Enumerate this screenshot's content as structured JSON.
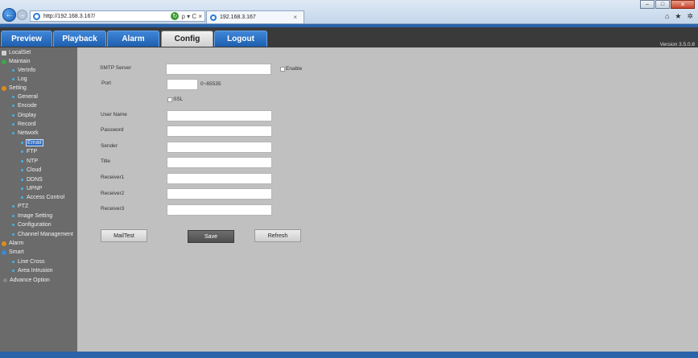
{
  "browser": {
    "url": "http://192.168.3.167/",
    "tab_title": "192.168.3.167",
    "back_glyph": "←",
    "forward_glyph": "→",
    "search_glyph": "ρ ▾ C ×",
    "tab_close": "×",
    "min_glyph": "–",
    "max_glyph": "□",
    "close_glyph": "✕",
    "home_glyph": "⌂",
    "star_glyph": "★",
    "gear_glyph": "✲"
  },
  "menu": {
    "preview": "Preview",
    "playback": "Playback",
    "alarm": "Alarm",
    "config": "Config",
    "logout": "Logout",
    "active": "Config"
  },
  "version": "Version 3.5.0.8",
  "sidebar": {
    "items": [
      {
        "label": "LocalSet"
      },
      {
        "label": "Maintain"
      },
      {
        "label": "VerInfo"
      },
      {
        "label": "Log"
      },
      {
        "label": "Setting"
      },
      {
        "label": "General"
      },
      {
        "label": "Encode"
      },
      {
        "label": "Display"
      },
      {
        "label": "Record"
      },
      {
        "label": "Network"
      },
      {
        "label": "Email"
      },
      {
        "label": "FTP"
      },
      {
        "label": "NTP"
      },
      {
        "label": "Cloud"
      },
      {
        "label": "DDNS"
      },
      {
        "label": "UPNP"
      },
      {
        "label": "Access Control"
      },
      {
        "label": "PTZ"
      },
      {
        "label": "Image Setting"
      },
      {
        "label": "Configuration"
      },
      {
        "label": "Channel Management"
      },
      {
        "label": "Alarm"
      },
      {
        "label": "Smart"
      },
      {
        "label": "Line Cross"
      },
      {
        "label": "Area Intrusion"
      },
      {
        "label": "Advance Option"
      }
    ]
  },
  "form": {
    "smtp_label": "SMTP Server",
    "smtp_value": "",
    "enable_label": "Enable",
    "port_label": "Port",
    "port_value": "",
    "port_range": "0~65535",
    "ssl_label": "SSL",
    "username_label": "User Name",
    "username_value": "",
    "password_label": "Password",
    "password_value": "",
    "sender_label": "Sender",
    "sender_value": "",
    "title_label": "Title",
    "title_value": "",
    "receiver1_label": "Receiver1",
    "receiver1_value": "",
    "receiver2_label": "Receiver2",
    "receiver2_value": "",
    "receiver3_label": "Receiver3",
    "receiver3_value": ""
  },
  "buttons": {
    "mailtest": "MailTest",
    "save": "Save",
    "refresh": "Refresh"
  },
  "colors": {
    "accent": "#2b63a8",
    "menu_blue": "#2f74c7",
    "sidebar_bg": "#6b6b6b",
    "content_bg": "#c0c0c0"
  }
}
